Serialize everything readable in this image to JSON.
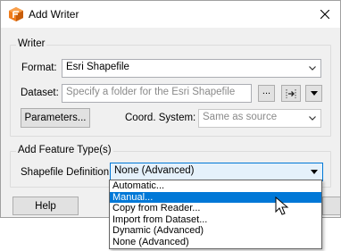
{
  "window": {
    "title": "Add Writer"
  },
  "writer_group": {
    "title": "Writer",
    "format_label": "Format:",
    "format_value": "Esri Shapefile",
    "dataset_label": "Dataset:",
    "dataset_placeholder": "Specify a folder for the Esri Shapefile",
    "browse_label": "...",
    "parameters_label": "Parameters...",
    "coord_label": "Coord. System:",
    "coord_value": "Same as source"
  },
  "feature_group": {
    "title": "Add Feature Type(s)",
    "shapefile_def_label": "Shapefile Definition:",
    "shapefile_def_value": "None (Advanced)",
    "options": [
      "Automatic...",
      "Manual...",
      "Copy from Reader...",
      "Import from Dataset...",
      "Dynamic (Advanced)",
      "None (Advanced)"
    ],
    "highlighted_index": 1
  },
  "footer": {
    "help_label": "Help"
  },
  "colors": {
    "accent": "#0078d7",
    "dialog_bg": "#f0f0f0",
    "brand_orange": "#f07c1b"
  }
}
